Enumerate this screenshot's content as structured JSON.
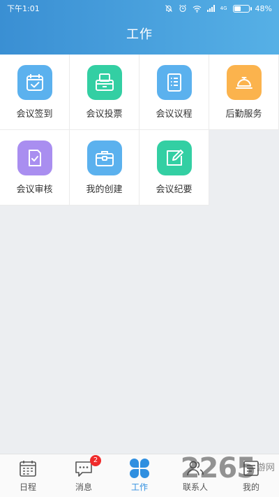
{
  "status_bar": {
    "time": "下午1:01",
    "network": "4G",
    "battery": "48%",
    "battery_level": 0.48
  },
  "header": {
    "title": "工作"
  },
  "tiles": [
    {
      "label": "会议签到",
      "icon": "calendar-check-icon",
      "color": "#5bb1ee"
    },
    {
      "label": "会议投票",
      "icon": "ballot-box-icon",
      "color": "#33cfa3"
    },
    {
      "label": "会议议程",
      "icon": "agenda-list-icon",
      "color": "#5bb1ee"
    },
    {
      "label": "后勤服务",
      "icon": "service-bell-icon",
      "color": "#fbb34d"
    },
    {
      "label": "会议审核",
      "icon": "document-check-icon",
      "color": "#a98ef0"
    },
    {
      "label": "我的创建",
      "icon": "briefcase-icon",
      "color": "#5bb1ee"
    },
    {
      "label": "会议纪要",
      "icon": "edit-note-icon",
      "color": "#33cfa3"
    }
  ],
  "tabbar": {
    "items": [
      {
        "label": "日程",
        "icon": "calendar-icon",
        "active": false
      },
      {
        "label": "消息",
        "icon": "message-icon",
        "active": false,
        "badge": "2"
      },
      {
        "label": "工作",
        "icon": "clover-icon",
        "active": true
      },
      {
        "label": "联系人",
        "icon": "contacts-icon",
        "active": false
      },
      {
        "label": "我的",
        "icon": "profile-icon",
        "active": false
      }
    ],
    "active_color": "#2f8fe0"
  },
  "watermark": {
    "number": "2265",
    "text": "游网"
  }
}
